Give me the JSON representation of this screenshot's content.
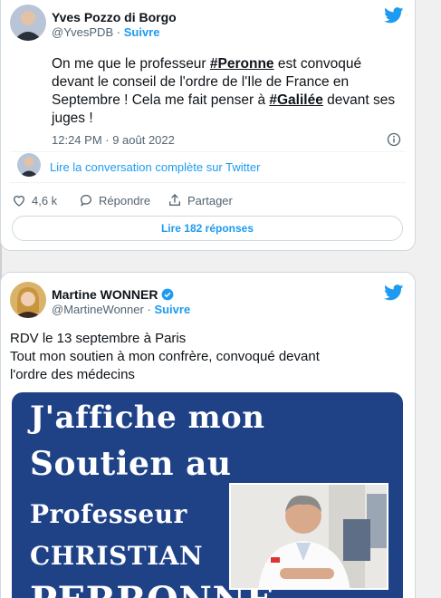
{
  "tweet1": {
    "author_name": "Yves Pozzo di Borgo",
    "handle": "@YvesPDB",
    "separator": "·",
    "follow_label": "Suivre",
    "text_parts": [
      "On me que le professeur ",
      "#Peronne",
      " est convoqué devant le conseil de l'ordre de l'Ile de France en Septembre ! Cela me fait penser à ",
      "#Galilée",
      " devant ses juges !"
    ],
    "timestamp": "12:24 PM · 9 août 2022",
    "conversation_link": "Lire la conversation complète sur Twitter",
    "likes": "4,6 k",
    "reply_label": "Répondre",
    "share_label": "Partager",
    "read_replies": "Lire 182 réponses"
  },
  "tweet2": {
    "author_name": "Martine WONNER",
    "handle": "@MartineWonner",
    "separator": "·",
    "follow_label": "Suivre",
    "text_line1": "RDV le 13 septembre à Paris",
    "text_line2": "Tout mon soutien à mon confrère, convoqué devant",
    "text_line3": "l'ordre des médecins",
    "poster": {
      "line1": "J'affiche mon",
      "line2": "Soutien au",
      "line3": "Professeur",
      "line4": "CHRISTIAN",
      "line5": "PERRONNE"
    }
  },
  "colors": {
    "accent": "#1d9bf0",
    "poster_bg": "#1f4287"
  },
  "icons": [
    "twitter-bird-icon",
    "info-icon",
    "heart-icon",
    "reply-icon",
    "share-icon",
    "verified-badge-icon"
  ]
}
